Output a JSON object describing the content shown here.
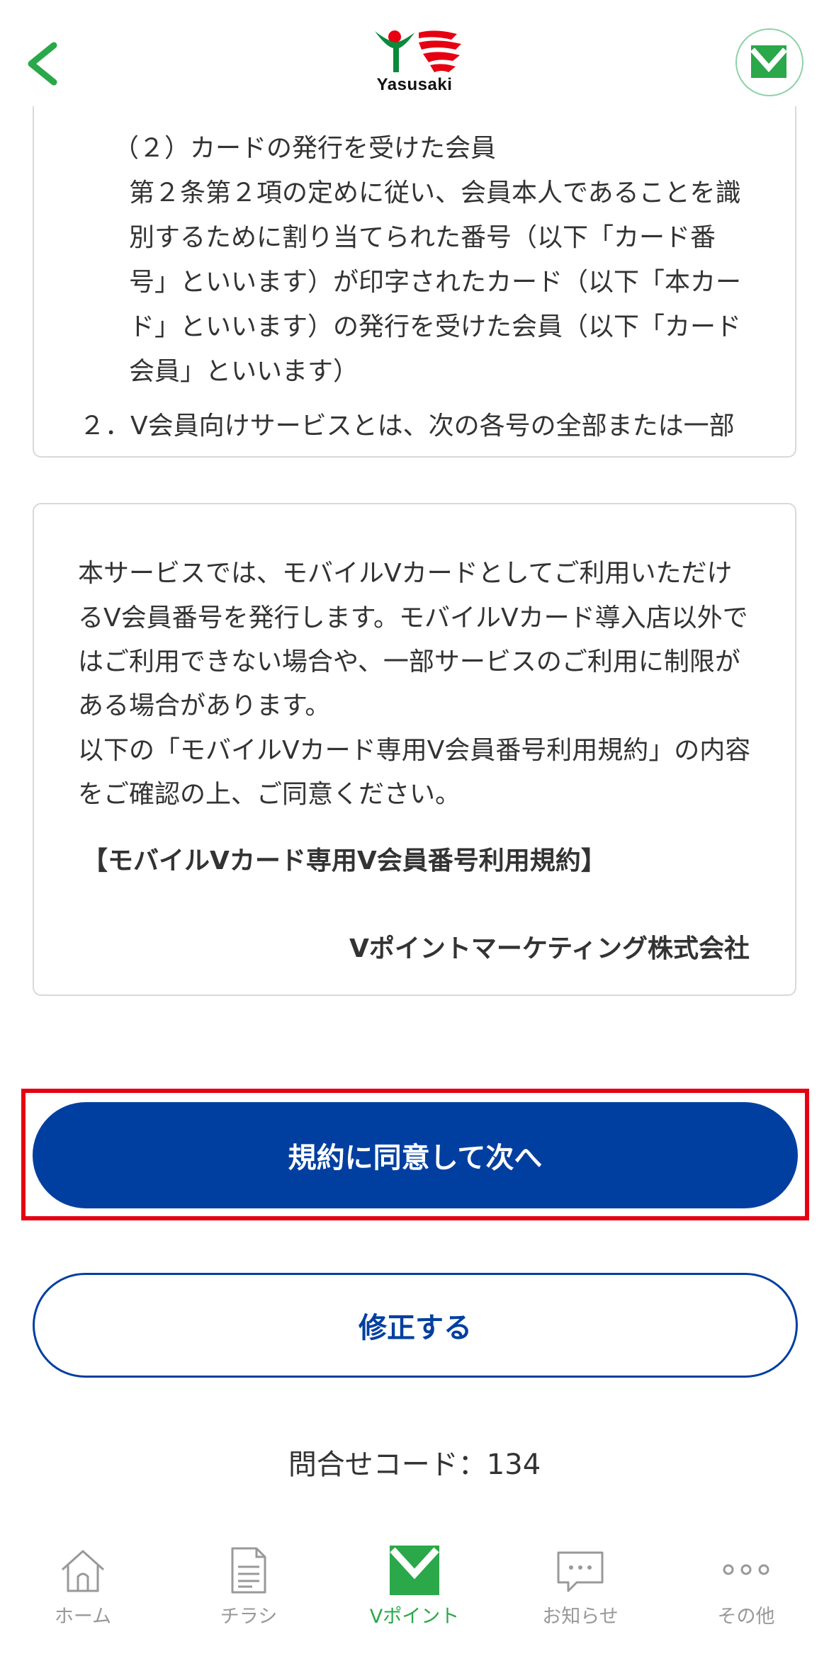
{
  "header": {
    "logo_text": "Yasusaki"
  },
  "terms_excerpt": {
    "lines": [
      "（２）カードの発行を受けた会員",
      "第２条第２項の定めに従い、会員本人であることを識",
      "別するために割り当てられた番号（以下「カード番",
      "号」といいます）が印字されたカード（以下「本カー",
      "ド」といいます）の発行を受けた会員（以下「カード",
      "会員」といいます）",
      "２．V会員向けサービスとは、次の各号の全部または一部"
    ]
  },
  "info": {
    "lines": [
      "本サービスでは、モバイルVカードとしてご利用いただけ",
      "るV会員番号を発行します。モバイルVカード導入店以外で",
      "はご利用できない場合や、一部サービスのご利用に制限が",
      "ある場合があります。",
      "以下の「モバイルVカード専用V会員番号利用規約」の内容",
      "をご確認の上、ご同意ください。"
    ],
    "terms_title": "【モバイルVカード専用V会員番号利用規約】",
    "company": "Vポイントマーケティング株式会社"
  },
  "actions": {
    "agree_label": "規約に同意して次へ",
    "edit_label": "修正する"
  },
  "inquiry_code": "問合せコード：134",
  "tabbar": {
    "items": [
      {
        "label": "ホーム",
        "icon": "home-icon"
      },
      {
        "label": "チラシ",
        "icon": "flyer-icon"
      },
      {
        "label": "Vポイント",
        "icon": "vpoint-icon"
      },
      {
        "label": "お知らせ",
        "icon": "message-icon"
      },
      {
        "label": "その他",
        "icon": "more-icon"
      }
    ],
    "active_index": 2
  },
  "colors": {
    "primary_blue": "#003fa0",
    "accent_green": "#2aa84a",
    "highlight_red": "#e60012"
  }
}
